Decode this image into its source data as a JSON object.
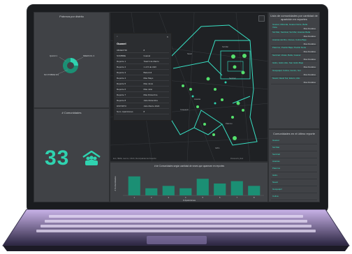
{
  "dashboard": {
    "pie_panel_title": "Pobreza por distrito",
    "pie_labels": [
      "Quintil 1",
      "MIERCOL 3",
      "NO POBRE 9%"
    ],
    "count_panel_title": "# Comunidades",
    "community_count": "33",
    "map_credit": "Esri, HERE, Garmin, USGS, Municipalidad de Navarrito",
    "map_credit_right": "Powered by Esri",
    "map_places": [
      "Naval",
      "Sol Mar",
      "Sentinal",
      "Acacias",
      "Guayaquil",
      "Palermo",
      "Isidro"
    ],
    "popup": {
      "title": "Guanel",
      "rows": [
        [
          "OBJECTID",
          "8"
        ],
        [
          "NOMBRE",
          "Guanel"
        ],
        [
          "Reporte 1",
          "Total 9 de Marzo"
        ],
        [
          "Reporte 2",
          "1 of 6 de Abril"
        ],
        [
          "Reporte 3",
          "Bala Anil"
        ],
        [
          "Reporte 4",
          "Mas Mayo"
        ],
        [
          "Reporte 5",
          "Mas Junio"
        ],
        [
          "Reporte 6",
          "Mas Julio"
        ],
        [
          "Reporte 7",
          "Mas Diciembre"
        ],
        [
          "Reporte 8",
          "Julio Diciembre"
        ],
        [
          "DISTRITO",
          "Julio Marzo 2022"
        ],
        [
          "Num. Apariciones",
          "8"
        ]
      ]
    },
    "right_panel_title": "Lista de comunidades por cantidad de aparición en reportes",
    "right_items": [
      {
        "name": "Guanel, Miranda, Guanel Norte, Bella Vista",
        "tag": "Mas Detalles"
      },
      {
        "name": "Sol Mar, Sentinal, Sol Mar, Acacias Bella",
        "tag": "Mas Detalles"
      },
      {
        "name": "Acacias del Rio, Cisnes, Colina Baja",
        "tag": "Mas Detalles"
      },
      {
        "name": "Palermo, Pueblo Baja, Pueblo Norte",
        "tag": "Mas Detalles"
      },
      {
        "name": "Sentinal, Vistas, Bella, Guanel",
        "tag": "Mas Detalles"
      },
      {
        "name": "Isidro, Isidro Alto, San Isidro Bajo",
        "tag": "Mas Detalles"
      },
      {
        "name": "Guayaquil, Colina, Centro, Sol",
        "tag": "Mas Detalles"
      },
      {
        "name": "Naval, Naval Sur, Estero, Alto",
        "tag": "Mas Detalles"
      }
    ],
    "bottom_right_title": "Comunidades en el último reporte",
    "bottom_right_items": [
      "Guanel",
      "Sol Mar",
      "Sentinal",
      "Acacias",
      "Palermo",
      "Isidro",
      "Naval",
      "Guayaquil",
      "Colina",
      "Cisnes"
    ]
  },
  "chart_data": {
    "type": "bar",
    "title": "# de Comunidades según cantidad de veces que aparecen en reportes",
    "xlabel": "# Apariciones",
    "ylabel": "# Comunidades",
    "categories": [
      "1",
      "2",
      "3",
      "4",
      "5",
      "6",
      "7",
      "8"
    ],
    "values": [
      8,
      3,
      4,
      3,
      7,
      5,
      6,
      4
    ],
    "ylim": [
      0,
      10
    ],
    "bar_color": "#1b8f74"
  },
  "colors": {
    "accent": "#2fd3b0",
    "point": "#55e06c",
    "map_bg": "#1f2124"
  }
}
